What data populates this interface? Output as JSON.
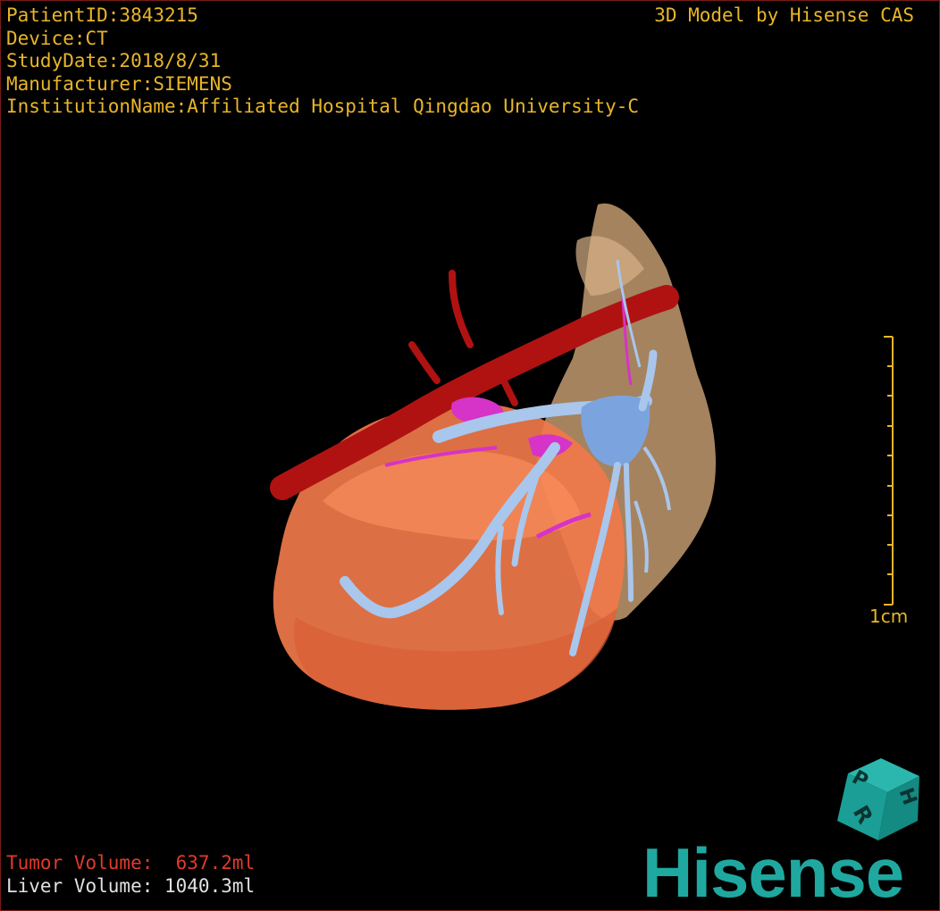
{
  "header": {
    "patient_id": "PatientID:3843215",
    "device": "Device:CT",
    "study_date": "StudyDate:2018/8/31",
    "manufacturer": "Manufacturer:SIEMENS",
    "institution": "InstitutionName:Affiliated Hospital Qingdao University-C",
    "credit": "3D Model by Hisense CAS"
  },
  "volumes": {
    "tumor": "Tumor Volume:  637.2ml",
    "liver": "Liver Volume: 1040.3ml"
  },
  "scale": {
    "label": "1cm"
  },
  "orientation_cube": {
    "faces": [
      "H",
      "P",
      "R"
    ]
  },
  "logo": {
    "text": "Hisense"
  },
  "colors": {
    "overlay_text": "#e8b52a",
    "tumor_text": "#e23a2a",
    "liver_text": "#e0e0e0",
    "tumor_mass": "#f0784a",
    "liver": "#c9a074",
    "artery": "#b01212",
    "portal_vein": "#a9c6ec",
    "hepatic_vein": "#d633c8",
    "logo": "#1fa8a0"
  }
}
